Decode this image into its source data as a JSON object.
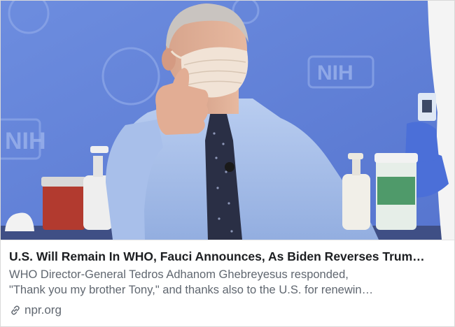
{
  "card": {
    "headline": "U.S. Will Remain In WHO, Fauci Announces, As Biden Reverses Trum…",
    "description_line1": "WHO Director-General Tedros Adhanom Ghebreyesus responded,",
    "description_line2": "\"Thank you my brother Tony,\" and thanks also to the U.S. for renewin…",
    "domain": "npr.org",
    "link_icon": "link-icon"
  },
  "photo": {
    "backdrop_text": "NIH",
    "backdrop_color": "#5f7fd6",
    "shirt_color": "#a9c0ea",
    "mask_color": "#f1e3d6",
    "glove_color": "#4b6fd8"
  }
}
